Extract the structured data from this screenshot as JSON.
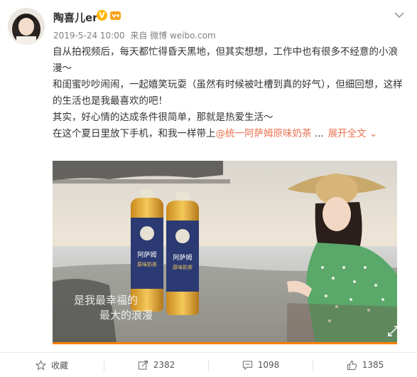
{
  "post": {
    "author": "陶喜儿er",
    "verified_badge": "V",
    "timestamp": "2019-5-24 10:00",
    "source": "来自 微博 weibo.com",
    "lines": [
      "自从拍视频后，每天都忙得昏天黑地，但其实想想，工作中也有很多不经意的小浪漫～",
      "和闺蜜吵吵闹闹，一起嬉笑玩耍（虽然有时候被吐槽到真的好气），但细回想，这样的生活也是我最喜欢的吧！",
      "其实，好心情的达成条件很简单，那就是热爱生活～"
    ],
    "last_line_text": "在这个夏日里放下手机，和我一样带上",
    "mention_link": "@统一阿萨姆原味奶茶",
    "ellipsis": " ...",
    "expand_label": "展开全文 ⌄"
  },
  "video": {
    "subtitle_line1": "是我最幸福的",
    "subtitle_line2": "最大的浪漫",
    "bottle_label": "阿萨姆",
    "bottle_sub": "原味奶茶"
  },
  "actions": {
    "favorite": "收藏",
    "repost": "2382",
    "comment": "1098",
    "like": "1385"
  },
  "colors": {
    "link": "#eb7350",
    "progress": "#ff8200",
    "badge": "#ffb400"
  }
}
